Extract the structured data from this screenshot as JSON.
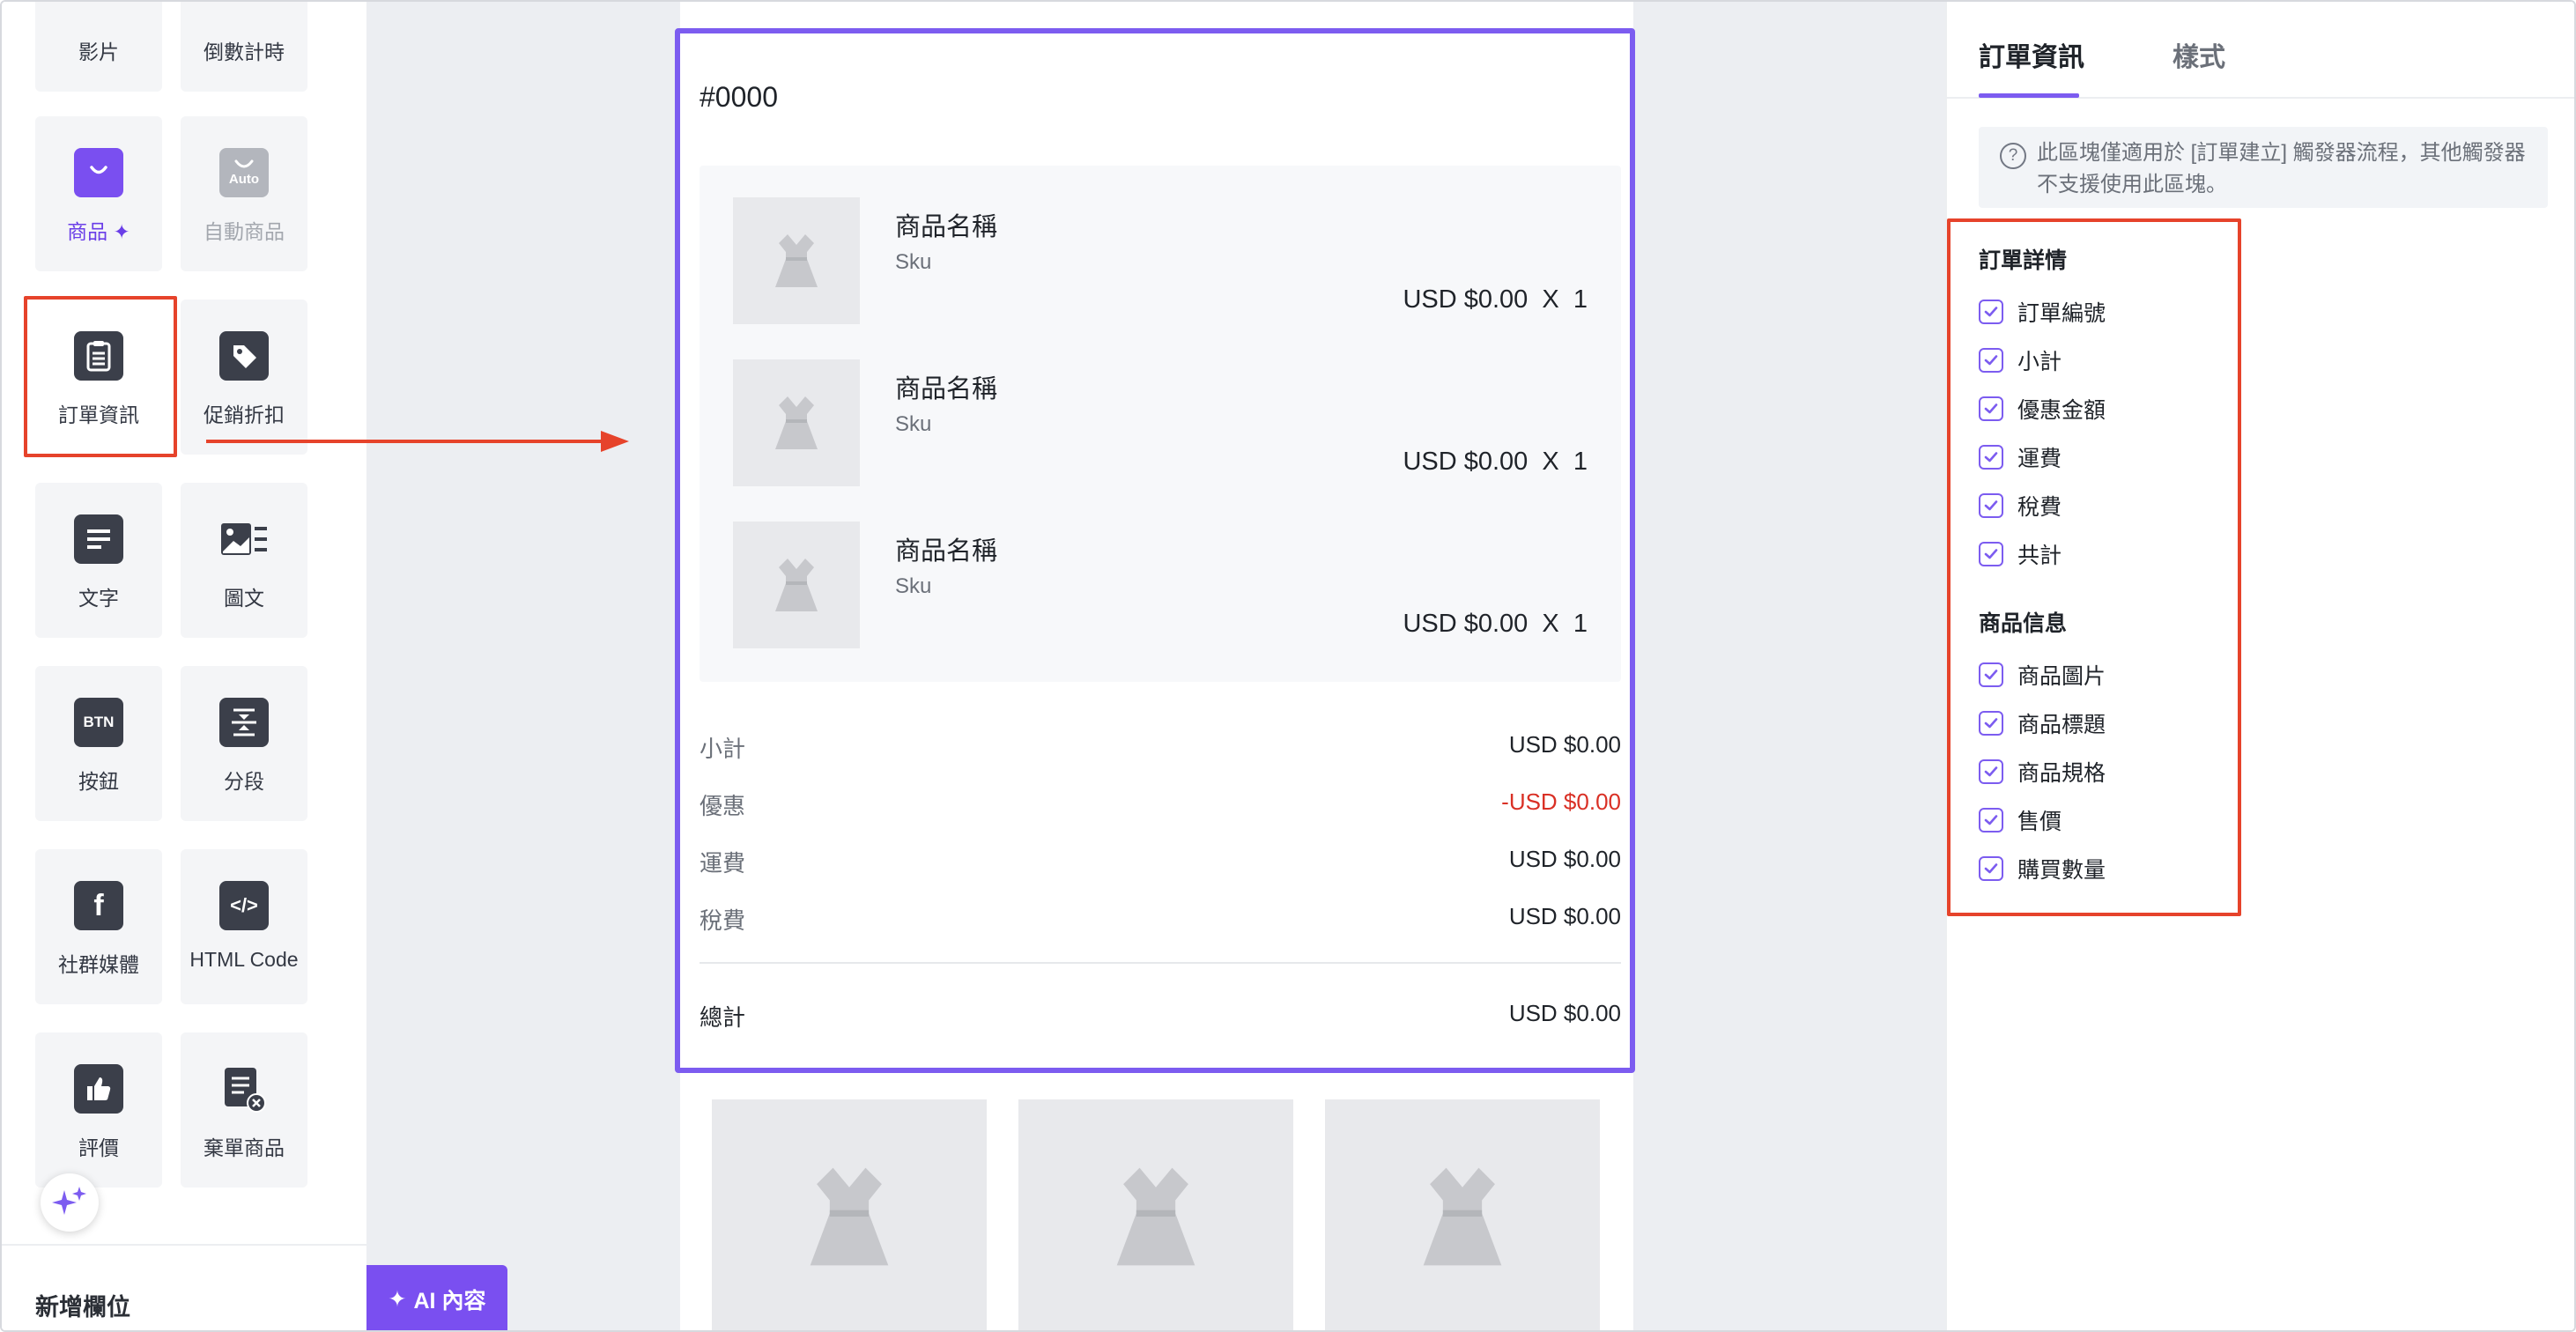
{
  "palette": {
    "tiles": [
      {
        "label": "影片"
      },
      {
        "label": "倒數計時"
      },
      {
        "label": "商品"
      },
      {
        "label": "自動商品",
        "badge": "Auto"
      },
      {
        "label": "訂單資訊"
      },
      {
        "label": "促銷折扣"
      },
      {
        "label": "文字"
      },
      {
        "label": "圖文"
      },
      {
        "label": "按鈕",
        "badge": "BTN"
      },
      {
        "label": "分段"
      },
      {
        "label": "社群媒體"
      },
      {
        "label": "HTML Code"
      },
      {
        "label": "評價"
      },
      {
        "label": "棄單商品"
      }
    ],
    "footer_title": "新增欄位"
  },
  "canvas": {
    "ai_button_label": "AI 內容",
    "order_number": "#0000",
    "items": [
      {
        "name": "商品名稱",
        "sku": "Sku",
        "price": "USD $0.00  X  1"
      },
      {
        "name": "商品名稱",
        "sku": "Sku",
        "price": "USD $0.00  X  1"
      },
      {
        "name": "商品名稱",
        "sku": "Sku",
        "price": "USD $0.00  X  1"
      }
    ],
    "summary": {
      "subtotal_label": "小計",
      "subtotal_value": "USD $0.00",
      "discount_label": "優惠",
      "discount_value": "-USD $0.00",
      "shipping_label": "運費",
      "shipping_value": "USD $0.00",
      "tax_label": "稅費",
      "tax_value": "USD $0.00",
      "total_label": "總計",
      "total_value": "USD $0.00"
    }
  },
  "panel": {
    "tab_active": "訂單資訊",
    "tab_inactive": "樣式",
    "notice": "此區塊僅適用於 [訂單建立] 觸發器流程，其他觸發器不支援使用此區塊。",
    "order_section_title": "訂單詳情",
    "order_options": [
      "訂單編號",
      "小計",
      "優惠金額",
      "運費",
      "稅費",
      "共計"
    ],
    "product_section_title": "商品信息",
    "product_options": [
      "商品圖片",
      "商品標題",
      "商品規格",
      "售價",
      "購買數量"
    ]
  },
  "colors": {
    "accent": "#7c5cf0",
    "highlight_red": "#e6432b",
    "discount_red": "#d93025"
  }
}
